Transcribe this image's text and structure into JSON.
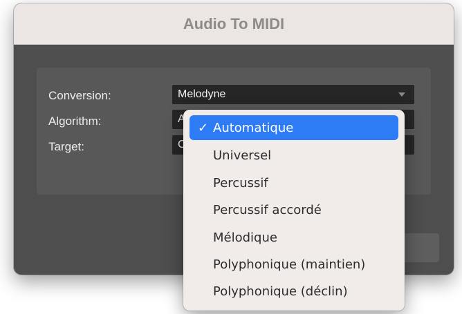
{
  "dialog": {
    "title": "Audio To MIDI",
    "fields": [
      {
        "label": "Conversion:",
        "value": "Melodyne"
      },
      {
        "label": "Algorithm:",
        "value": "A"
      },
      {
        "label": "Target:",
        "value": "C"
      }
    ]
  },
  "menu": {
    "selected_index": 0,
    "check_icon": "✓",
    "items": [
      "Automatique",
      "Universel",
      "Percussif",
      "Percussif accordé",
      "Mélodique",
      "Polyphonique (maintien)",
      "Polyphonique (déclin)"
    ]
  },
  "colors": {
    "selection": "#2d7cf5",
    "window_bg": "#4e4e4e",
    "titlebar_bg": "#ebe6e3"
  }
}
